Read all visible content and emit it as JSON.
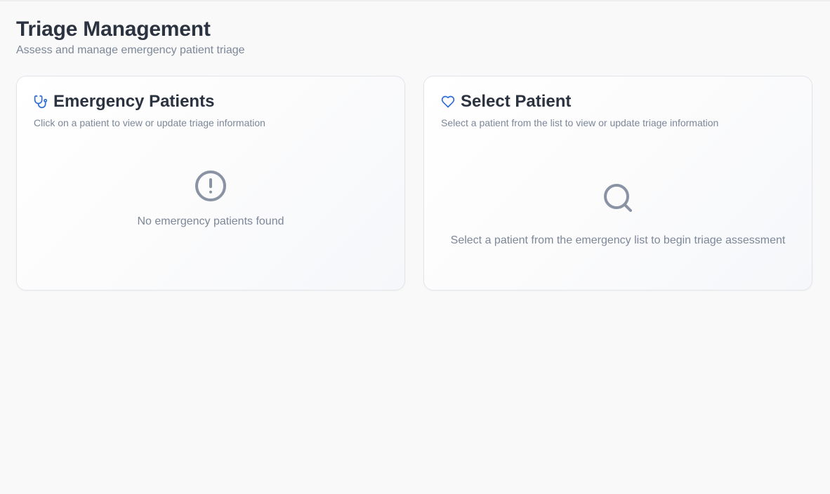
{
  "page": {
    "title": "Triage Management",
    "subtitle": "Assess and manage emergency patient triage"
  },
  "patients_panel": {
    "title": "Emergency Patients",
    "description": "Click on a patient to view or update triage information",
    "icon": "stethoscope-icon",
    "empty_icon": "alert-circle-icon",
    "empty_message": "No emergency patients found"
  },
  "details_panel": {
    "title": "Select Patient",
    "description": "Select a patient from the list to view or update triage information",
    "icon": "heart-icon",
    "empty_icon": "search-icon",
    "empty_message": "Select a patient from the emergency list to begin triage assessment"
  },
  "colors": {
    "accent": "#2d6bd6",
    "muted_icon": "#8a93a3",
    "title_text": "#2c3340",
    "muted_text": "#7c8798",
    "background": "#f9f9f9"
  }
}
